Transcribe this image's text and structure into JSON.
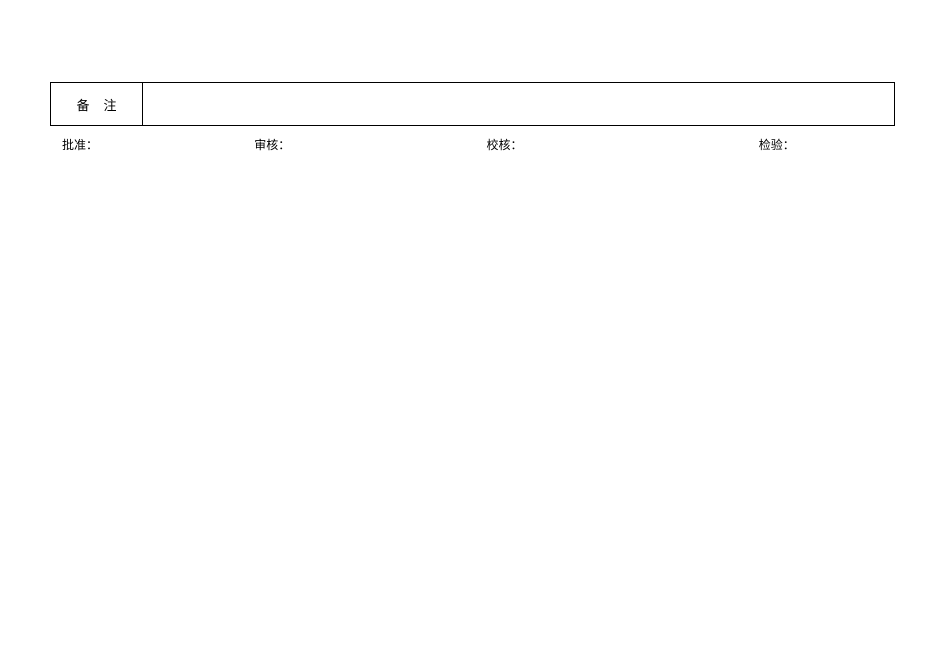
{
  "remarks": {
    "label": "备注",
    "value": ""
  },
  "signatures": {
    "approve": "批准：",
    "review": "审核：",
    "check": "校核：",
    "inspect": "检验："
  }
}
